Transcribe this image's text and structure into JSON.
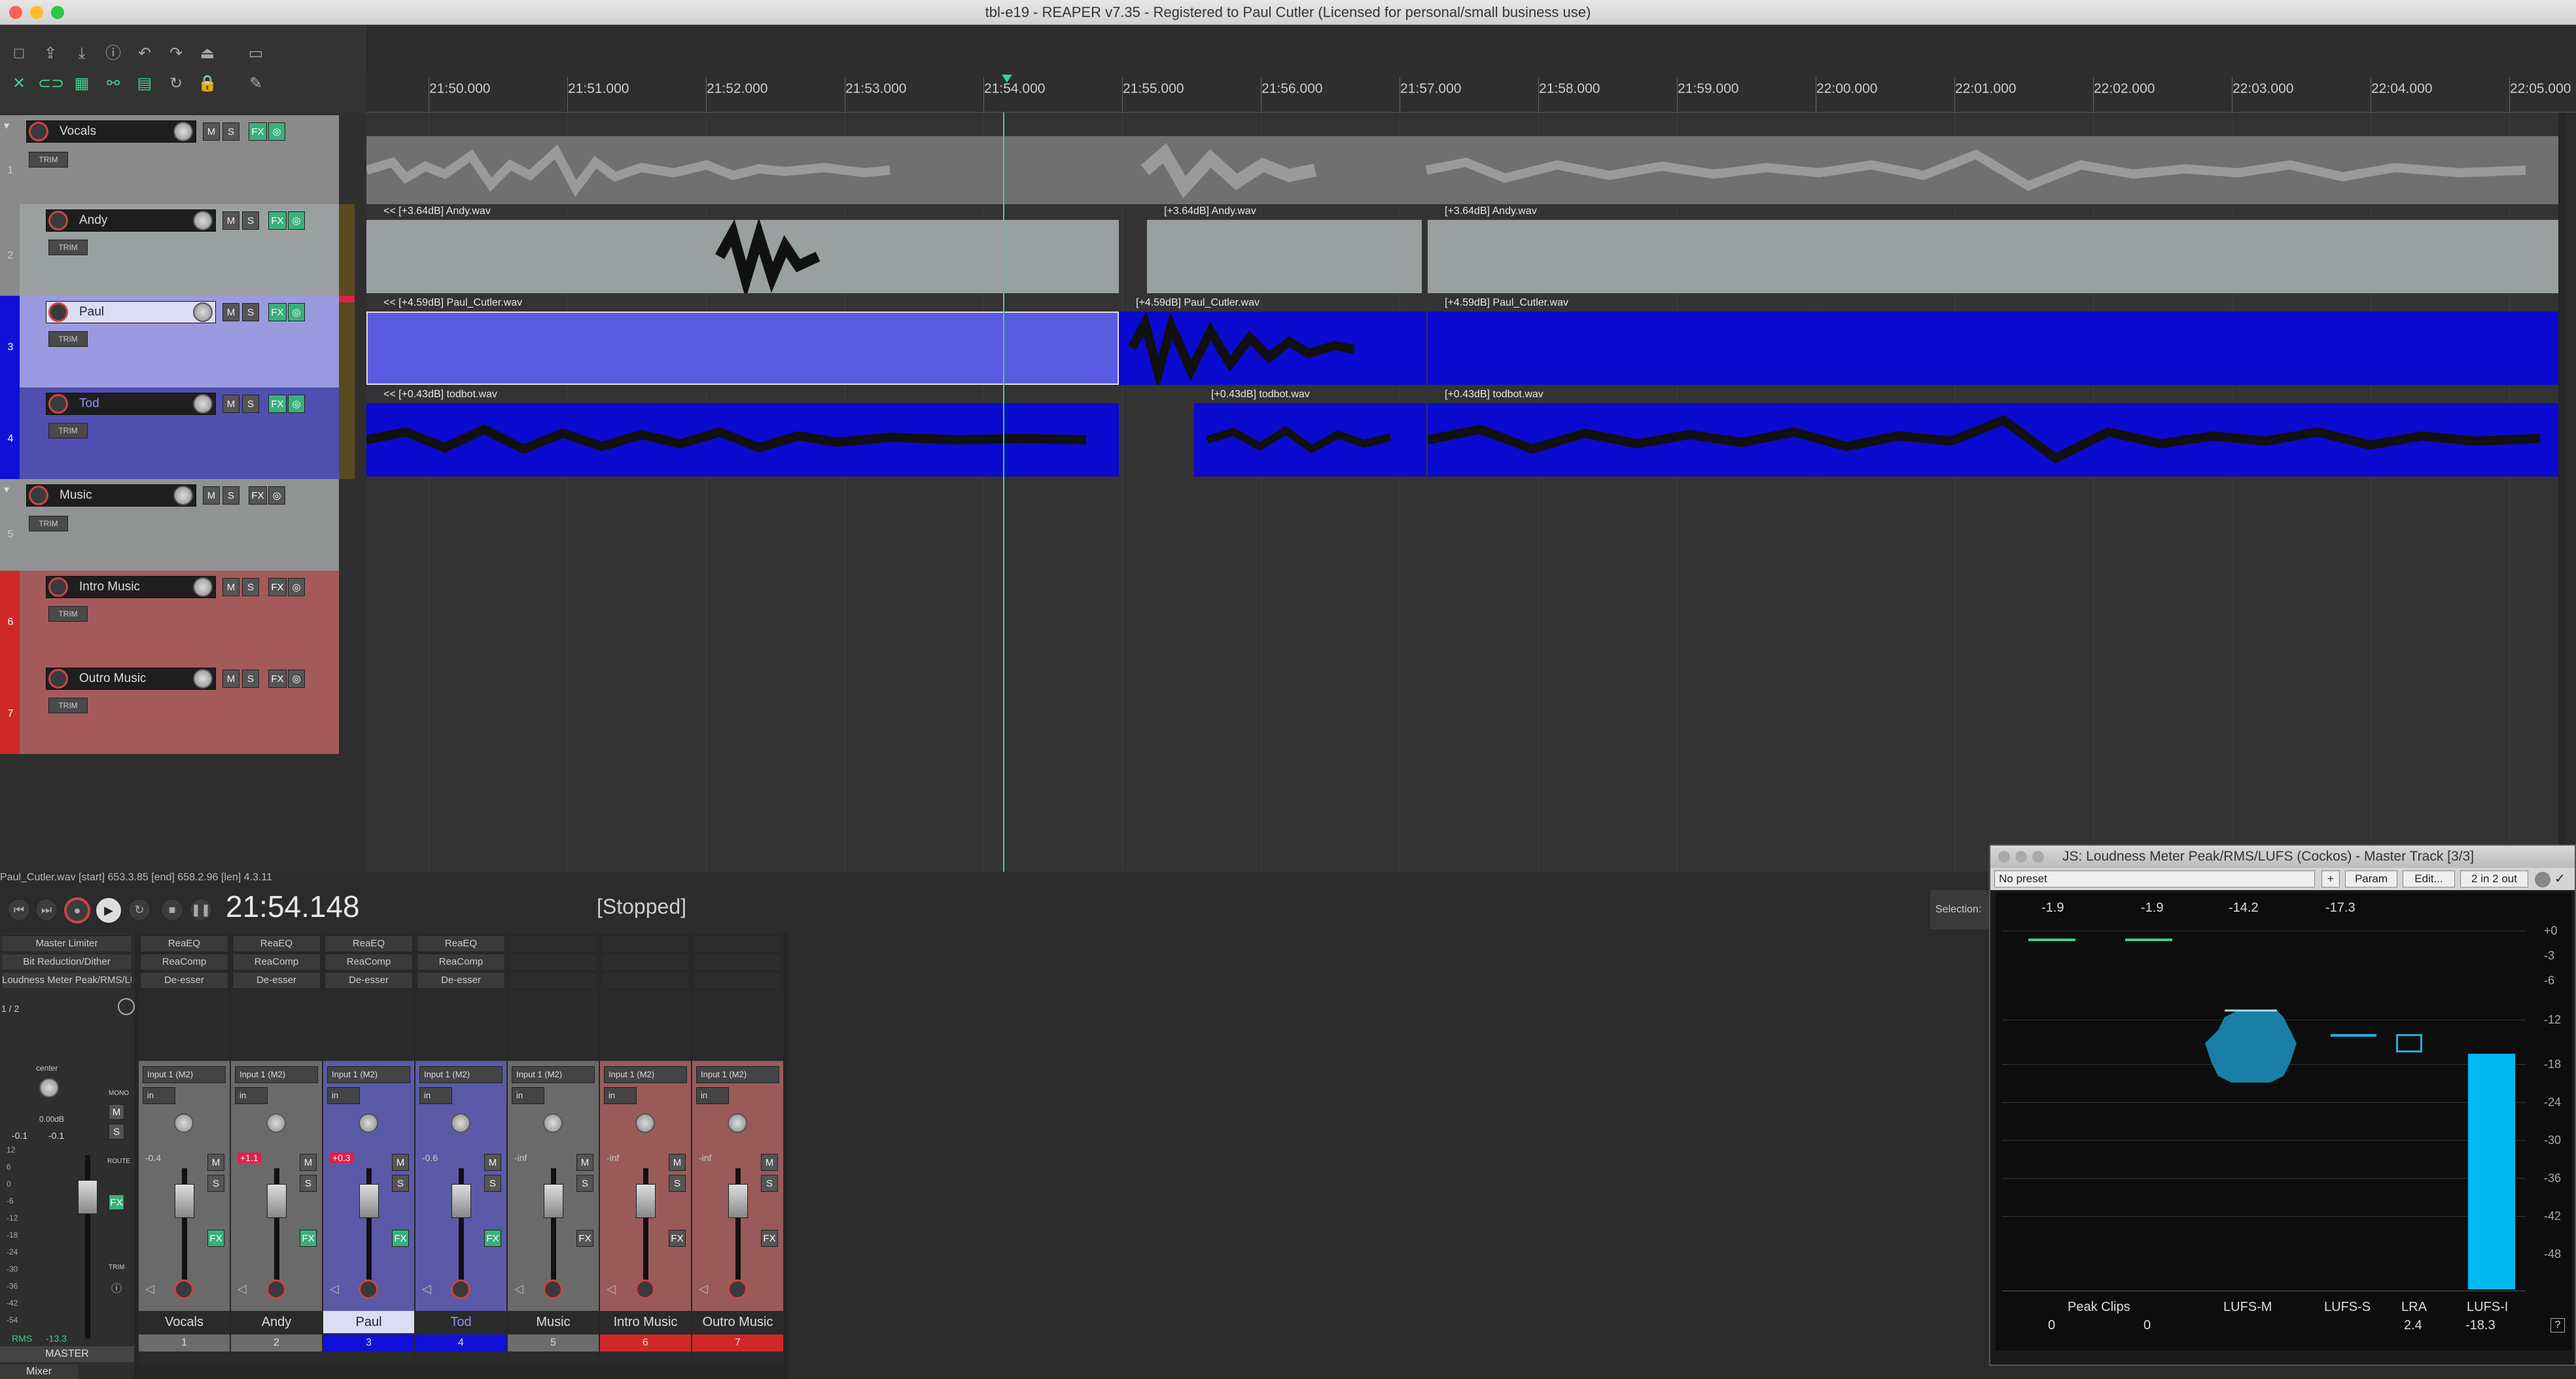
{
  "window": {
    "title": "tbl-e19 - REAPER v7.35 - Registered to Paul Cutler (Licensed for personal/small business use)"
  },
  "ruler": {
    "ticks": [
      "21:50.000",
      "21:51.000",
      "21:52.000",
      "21:53.000",
      "21:54.000",
      "21:55.000",
      "21:56.000",
      "21:57.000",
      "21:58.000",
      "21:59.000",
      "22:00.000",
      "22:01.000",
      "22:02.000",
      "22:03.000",
      "22:04.000",
      "22:05.000"
    ]
  },
  "tracks": [
    {
      "num": "1",
      "name": "Vocals",
      "trim": "TRIM",
      "folder": true
    },
    {
      "num": "2",
      "name": "Andy",
      "trim": "TRIM"
    },
    {
      "num": "3",
      "name": "Paul",
      "trim": "TRIM"
    },
    {
      "num": "4",
      "name": "Tod",
      "trim": "TRIM"
    },
    {
      "num": "5",
      "name": "Music",
      "trim": "TRIM",
      "folder": true
    },
    {
      "num": "6",
      "name": "Intro Music",
      "trim": "TRIM"
    },
    {
      "num": "7",
      "name": "Outro Music",
      "trim": "TRIM"
    }
  ],
  "track_buttons": {
    "mute": "M",
    "solo": "S",
    "fx": "FX"
  },
  "items": {
    "andy": [
      "<< [+3.64dB] Andy.wav",
      "[+3.64dB] Andy.wav",
      "[+3.64dB] Andy.wav"
    ],
    "paul": [
      "<< [+4.59dB] Paul_Cutler.wav",
      "[+4.59dB] Paul_Cutler.wav",
      "[+4.59dB] Paul_Cutler.wav"
    ],
    "tod": [
      "<< [+0.43dB] todbot.wav",
      "[+0.43dB] todbot.wav",
      "[+0.43dB] todbot.wav"
    ]
  },
  "status_line": "Paul_Cutler.wav [start] 653.3.85 [end] 658.2.96 [len] 4.3.11",
  "transport": {
    "time": "21:54.148",
    "state": "[Stopped]",
    "selection_label": "Selection:"
  },
  "mixer": {
    "master": {
      "fx": [
        "Master Limiter",
        "Bit Reduction/Dither",
        "Loudness Meter Peak/RMS/LUFS"
      ],
      "page": "1 / 2",
      "pan": "center",
      "vol": "0.00dB",
      "peakL": "-0.1",
      "peakR": "-0.1",
      "mono": "MONO",
      "route": "ROUTE",
      "trim": "TRIM",
      "rms": "RMS",
      "rms_val": "-13.3",
      "name": "MASTER",
      "scale": [
        "12",
        "6",
        "0",
        "-6",
        "-12",
        "-18",
        "-24",
        "-30",
        "-36",
        "-42",
        "-54"
      ]
    },
    "strips": [
      {
        "name": "Vocals",
        "num": "1",
        "fx": [
          "ReaEQ",
          "ReaComp",
          "De-esser"
        ],
        "input": "Input 1 (M2)",
        "vol": "-0.4",
        "color": "#6c6c6c"
      },
      {
        "name": "Andy",
        "num": "2",
        "fx": [
          "ReaEQ",
          "ReaComp",
          "De-esser"
        ],
        "input": "Input 1 (M2)",
        "vol": "+1.1",
        "color": "#6c6c6c"
      },
      {
        "name": "Paul",
        "num": "3",
        "fx": [
          "ReaEQ",
          "ReaComp",
          "De-esser"
        ],
        "input": "Input 1 (M2)",
        "vol": "+0.3",
        "color": "#1010d8"
      },
      {
        "name": "Tod",
        "num": "4",
        "fx": [
          "ReaEQ",
          "ReaComp",
          "De-esser"
        ],
        "input": "Input 1 (M2)",
        "vol": "-0.6",
        "color": "#1010d8"
      },
      {
        "name": "Music",
        "num": "5",
        "fx": [],
        "input": "Input 1 (M2)",
        "vol": "-inf",
        "color": "#6c6c6c"
      },
      {
        "name": "Intro Music",
        "num": "6",
        "fx": [],
        "input": "Input 1 (M2)",
        "vol": "-inf",
        "color": "#d02828"
      },
      {
        "name": "Outro Music",
        "num": "7",
        "fx": [],
        "input": "Input 1 (M2)",
        "vol": "-inf",
        "color": "#d02828"
      }
    ],
    "in_label": "in",
    "tab": "Mixer"
  },
  "loudness": {
    "title": "JS: Loudness Meter Peak/RMS/LUFS (Cockos) - Master Track [3/3]",
    "preset": "No preset",
    "plus": "+",
    "param": "Param",
    "edit": "Edit...",
    "io": "2 in 2 out",
    "top_values": [
      "-1.9",
      "-1.9",
      "-14.2",
      "-17.3"
    ],
    "scale": [
      "+0",
      "-3",
      "-6",
      "-12",
      "-18",
      "-24",
      "-30",
      "-36",
      "-42",
      "-48"
    ],
    "labels": [
      "Peak Clips",
      "LUFS-M",
      "LUFS-S",
      "LRA",
      "LUFS-I"
    ],
    "bottom_values": [
      "0",
      "0",
      "2.4",
      "-18.3"
    ],
    "lufs_i": -18.3,
    "help": "?"
  },
  "colors": {
    "paul_item": "#0a0ad0",
    "paul_sel": "#5a5ae0",
    "andy_item": "#9aa0a0",
    "vocals": "#8a8a8a",
    "music": "#8f9391",
    "red_track": "#a45a5a",
    "meter": "#00b8f0"
  }
}
